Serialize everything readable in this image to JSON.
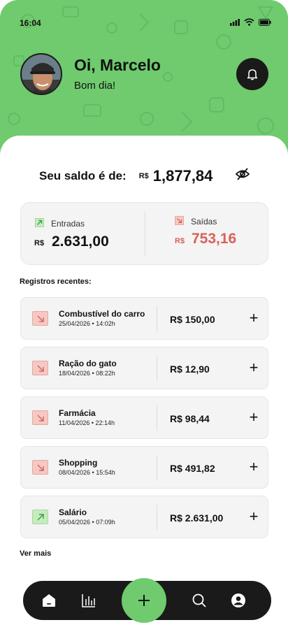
{
  "status": {
    "time": "16:04"
  },
  "header": {
    "greeting": "Oi, Marcelo",
    "subgreeting": "Bom dia!"
  },
  "balance": {
    "label": "Seu saldo é de:",
    "currency": "R$",
    "value": "1,877,84"
  },
  "summary": {
    "income": {
      "label": "Entradas",
      "currency": "R$",
      "value": "2.631,00"
    },
    "expense": {
      "label": "Saídas",
      "currency": "R$",
      "value": "753,16"
    }
  },
  "records_title": "Registros recentes:",
  "records": [
    {
      "name": "Combustível do carro",
      "date": "25/04/2026 • 14:02h",
      "amount": "R$ 150,00",
      "type": "out"
    },
    {
      "name": "Ração do gato",
      "date": "18/04/2026 • 08:22h",
      "amount": "R$ 12,90",
      "type": "out"
    },
    {
      "name": "Farmácia",
      "date": "11/04/2026 • 22:14h",
      "amount": "R$ 98,44",
      "type": "out"
    },
    {
      "name": "Shopping",
      "date": "08/04/2026 • 15:54h",
      "amount": "R$ 491,82",
      "type": "out"
    },
    {
      "name": "Salário",
      "date": "05/04/2026 • 07:09h",
      "amount": "R$ 2.631,00",
      "type": "in"
    }
  ],
  "see_more": "Ver mais",
  "colors": {
    "brand_green": "#6fcb6d",
    "expense_red": "#d8625a",
    "dark": "#1a1a1a"
  },
  "icons": [
    "signal-icon",
    "wifi-icon",
    "battery-icon",
    "bell-icon",
    "eye-off-icon",
    "arrow-up-right-icon",
    "arrow-down-right-icon",
    "plus-icon",
    "home-icon",
    "chart-icon",
    "search-icon",
    "profile-icon"
  ]
}
